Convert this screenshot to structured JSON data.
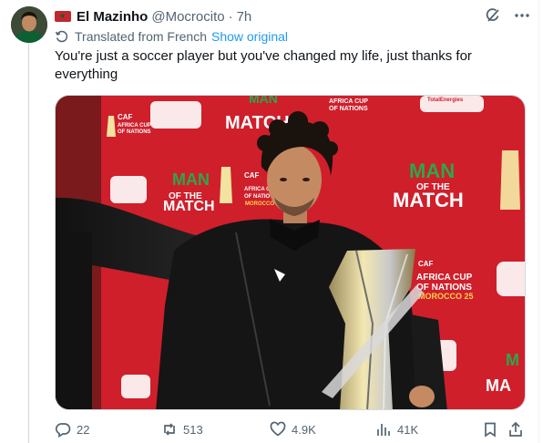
{
  "author": {
    "display_name": "El Mazinho",
    "handle": "@Mocrocito",
    "time": "7h"
  },
  "translation": {
    "label": "Translated from French",
    "link": "Show original"
  },
  "tweet": {
    "text": "You're just a soccer player but you've changed my life, just thanks for everything"
  },
  "media": {
    "backdrop_texts": [
      "MAN",
      "OF THE",
      "MATCH",
      "CAF",
      "AFRICA CUP",
      "OF NATIONS",
      "MOROCCO 25",
      "TotalEnergies"
    ]
  },
  "actions": {
    "replies": "22",
    "reposts": "513",
    "likes": "4.9K",
    "views": "41K"
  },
  "colors": {
    "accent": "#1d9bf0",
    "secondary_text": "#536471",
    "backdrop_red": "#d11f2a",
    "moroccan_green": "#1a8b3a"
  }
}
